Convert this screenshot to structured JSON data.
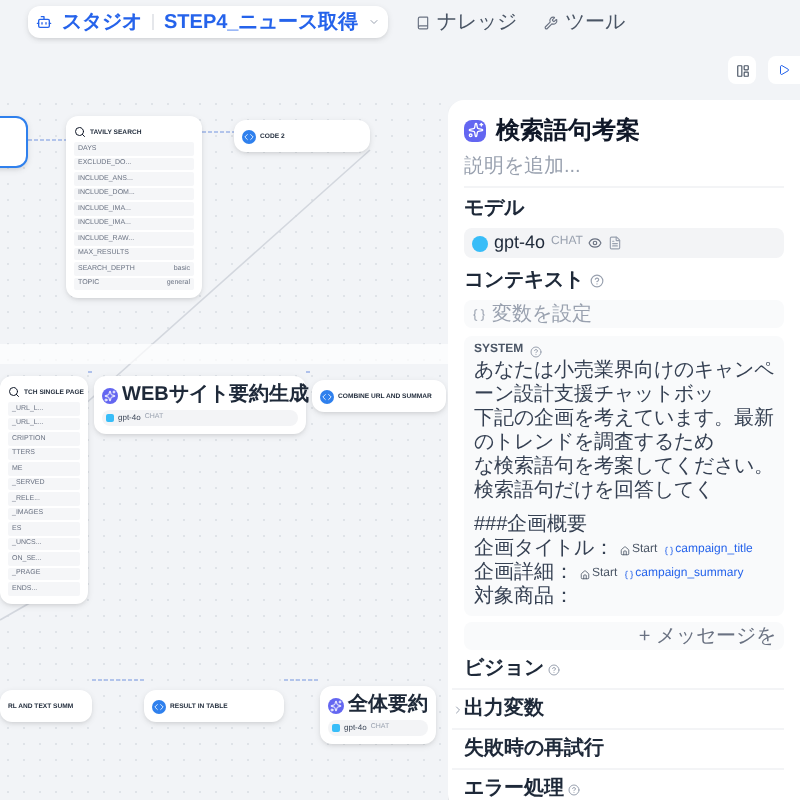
{
  "nav": {
    "studio": "スタジオ",
    "app": "STEP4_ニュース取得",
    "items": [
      "ナレッジ",
      "ツール"
    ]
  },
  "nodes": [
    {
      "kind": "blank",
      "selected": true
    },
    {
      "kind": "tool",
      "selected": false,
      "title": "TAVILY SEARCH",
      "rows": [
        {
          "name": "DAYS"
        },
        {
          "name": "EXCLUDE_DO..."
        },
        {
          "name": "INCLUDE_ANS..."
        },
        {
          "name": "INCLUDE_DOM..."
        },
        {
          "name": "INCLUDE_IMA..."
        },
        {
          "name": "INCLUDE_IMA..."
        },
        {
          "name": "INCLUDE_RAW..."
        },
        {
          "name": "MAX_RESULTS"
        },
        {
          "name": "SEARCH_DEPTH",
          "value": "basic"
        },
        {
          "name": "TOPIC",
          "value": "general"
        }
      ]
    },
    {
      "kind": "code",
      "selected": false,
      "title": "CODE 2"
    },
    {
      "kind": "tool",
      "selected": false,
      "title": "TCH SINGLE PAGE",
      "rows": [
        {
          "name": "_URL_L..."
        },
        {
          "name": "_URL_L..."
        },
        {
          "name": "CRIPTION"
        },
        {
          "name": "TTERS"
        },
        {
          "name": "ME"
        },
        {
          "name": "_SERVED"
        },
        {
          "name": "_RELE..."
        },
        {
          "name": "_IMAGES"
        },
        {
          "name": "ES"
        },
        {
          "name": "_UNCS..."
        },
        {
          "name": "ON_SE..."
        },
        {
          "name": "_PRAGE"
        },
        {
          "name": "ENDS..."
        }
      ]
    },
    {
      "kind": "llm",
      "selected": false,
      "title": "WEBサイト要約生成",
      "model": "gpt-4o",
      "mode": "CHAT"
    },
    {
      "kind": "code",
      "selected": false,
      "title": "COMBINE URL AND SUMMAR"
    },
    {
      "kind": "plain",
      "selected": false,
      "title": "RL AND TEXT SUMM"
    },
    {
      "kind": "code",
      "selected": false,
      "title": "RESULT IN TABLE"
    },
    {
      "kind": "llm",
      "selected": false,
      "title": "全体要約",
      "model": "gpt-4o",
      "mode": "CHAT"
    }
  ],
  "panel": {
    "title": "検索語句考案",
    "description_placeholder": "説明を追加...",
    "model_label": "モデル",
    "model": {
      "name": "gpt-4o",
      "mode": "CHAT"
    },
    "context": {
      "label": "コンテキスト",
      "placeholder": "変数を設定"
    },
    "system": {
      "label": "SYSTEM",
      "lines": [
        "あなたは小売業界向けのキャンペーン設計支援チャットボッ",
        "下記の企画を考えています。最新のトレンドを調査するため",
        "な検索語句を考案してください。検索語句だけを回答してく"
      ],
      "heading": "###企画概要",
      "fields": [
        {
          "label": "企画タイトル：",
          "source": "Start",
          "variable": "campaign_title"
        },
        {
          "label": "企画詳細：",
          "source": "Start",
          "variable": "campaign_summary"
        },
        {
          "label": "対象商品："
        }
      ]
    },
    "add_message": "+ メッセージを",
    "sections": [
      {
        "label": "ビジョン",
        "help": true
      },
      {
        "label": "出力変数",
        "help": false,
        "expanded": false
      },
      {
        "label": "失敗時の再試行",
        "help": false
      },
      {
        "label": "エラー処理",
        "help": true
      }
    ]
  }
}
